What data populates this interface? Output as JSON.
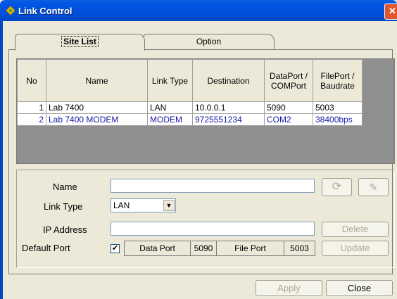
{
  "window": {
    "title": "Link Control",
    "close_glyph": "✕"
  },
  "tabs": [
    {
      "label": "Site List"
    },
    {
      "label": "Option"
    }
  ],
  "grid": {
    "headers": [
      "No",
      "Name",
      "Link Type",
      "Destination",
      "DataPort / COMPort",
      "FilePort / Baudrate"
    ],
    "rows": [
      [
        "1",
        "Lab 7400",
        "LAN",
        "10.0.0.1",
        "5090",
        "5003"
      ],
      [
        "2",
        "Lab 7400 MODEM",
        "MODEM",
        "9725551234",
        "COM2",
        "38400bps"
      ]
    ]
  },
  "form": {
    "name_label": "Name",
    "name_value": "",
    "link_type_label": "Link Type",
    "link_type_value": "LAN",
    "ip_label": "IP Address",
    "ip_value": "",
    "default_port_label": "Default Port",
    "default_port_checked": "✔",
    "data_port_label": "Data Port",
    "data_port_value": "5090",
    "file_port_label": "File Port",
    "file_port_value": "5003",
    "delete_label": "Delete",
    "update_label": "Update",
    "refresh_glyph": "⟳",
    "edit_glyph": "✎"
  },
  "footer": {
    "apply_label": "Apply",
    "close_label": "Close"
  }
}
